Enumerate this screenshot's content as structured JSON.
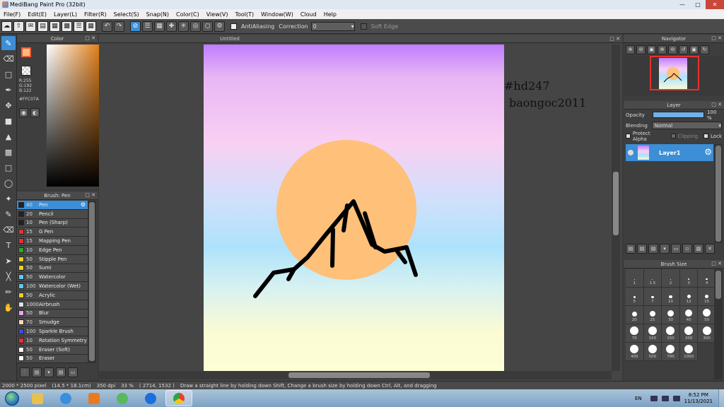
{
  "app": {
    "title": "MediBang Paint Pro (32bit)",
    "menus": [
      "File(F)",
      "Edit(E)",
      "Layer(L)",
      "Filter(R)",
      "Select(S)",
      "Snap(N)",
      "Color(C)",
      "View(V)",
      "Tool(T)",
      "Window(W)",
      "Cloud",
      "Help"
    ]
  },
  "toolbar": {
    "antialiasing_label": "AntiAliasing",
    "correction_label": "Correction",
    "correction_value": "0",
    "soft_edge_label": "Soft Edge"
  },
  "color_panel": {
    "title": "Color",
    "r": "R:255",
    "g": "G:192",
    "b": "B:122",
    "hex": "#FFC07A",
    "primary_color": "#ffc07a"
  },
  "brush_panel": {
    "title": "Brush: Pen",
    "brushes": [
      {
        "size": "40",
        "name": "Pen",
        "color": "#222222"
      },
      {
        "size": "20",
        "name": "Pencil",
        "color": "#222222"
      },
      {
        "size": "10",
        "name": "Pen (Sharp)",
        "color": "#222222"
      },
      {
        "size": "15",
        "name": "G Pen",
        "color": "#e83030"
      },
      {
        "size": "15",
        "name": "Mapping Pen",
        "color": "#e83030"
      },
      {
        "size": "10",
        "name": "Edge Pen",
        "color": "#22b022"
      },
      {
        "size": "50",
        "name": "Stipple Pen",
        "color": "#e8d020"
      },
      {
        "size": "50",
        "name": "Sumi",
        "color": "#e8d020"
      },
      {
        "size": "50",
        "name": "Watercolor",
        "color": "#60c8f0"
      },
      {
        "size": "100",
        "name": "Watercolor (Wet)",
        "color": "#60c8f0"
      },
      {
        "size": "50",
        "name": "Acrylic",
        "color": "#e8d020"
      },
      {
        "size": "1000",
        "name": "Airbrush",
        "color": "#e0e0e0"
      },
      {
        "size": "50",
        "name": "Blur",
        "color": "#f0a0f0"
      },
      {
        "size": "70",
        "name": "Smudge",
        "color": "#f8d8c0"
      },
      {
        "size": "100",
        "name": "Sparkle Brush",
        "color": "#3050e0"
      },
      {
        "size": "10",
        "name": "Rotation Symmetry",
        "color": "#e83030"
      },
      {
        "size": "50",
        "name": "Eraser (Soft)",
        "color": "#ffffff"
      },
      {
        "size": "50",
        "name": "Eraser",
        "color": "#ffffff"
      }
    ]
  },
  "canvas": {
    "tab_title": "Untitled",
    "sun_color": "#ffc07a",
    "mountain_color": "#000000"
  },
  "watermark": {
    "line1": "#hd247",
    "line2": "baongoc2011"
  },
  "navigator": {
    "title": "Navigator"
  },
  "layer_panel": {
    "title": "Layer",
    "opacity_label": "Opacity",
    "opacity_value": "100 %",
    "blending_label": "Blending",
    "blending_value": "Normal",
    "protect_alpha_label": "Protect Alpha",
    "clipping_label": "Clipping",
    "lock_label": "Lock",
    "layer_name": "Layer1"
  },
  "brush_size_panel": {
    "title": "Brush Size",
    "sizes": [
      "1",
      "1.5",
      "2",
      "3",
      "4",
      "5",
      "7",
      "10",
      "12",
      "15",
      "20",
      "25",
      "30",
      "40",
      "50",
      "70",
      "100",
      "150",
      "200",
      "300",
      "400",
      "500",
      "700",
      "1000"
    ]
  },
  "status": {
    "pixel_size": "2000 * 2500 pixel",
    "physical_size": "(14.5 * 18.1cm)",
    "dpi": "350 dpi",
    "zoom": "33 %",
    "cursor": "( 2714, 1532 )",
    "hint": "Draw a straight line by holding down Shift, Change a brush size by holding down Ctrl, Alt, and dragging"
  },
  "taskbar": {
    "language": "EN",
    "time": "8:52 PM",
    "date": "11/13/2021"
  }
}
